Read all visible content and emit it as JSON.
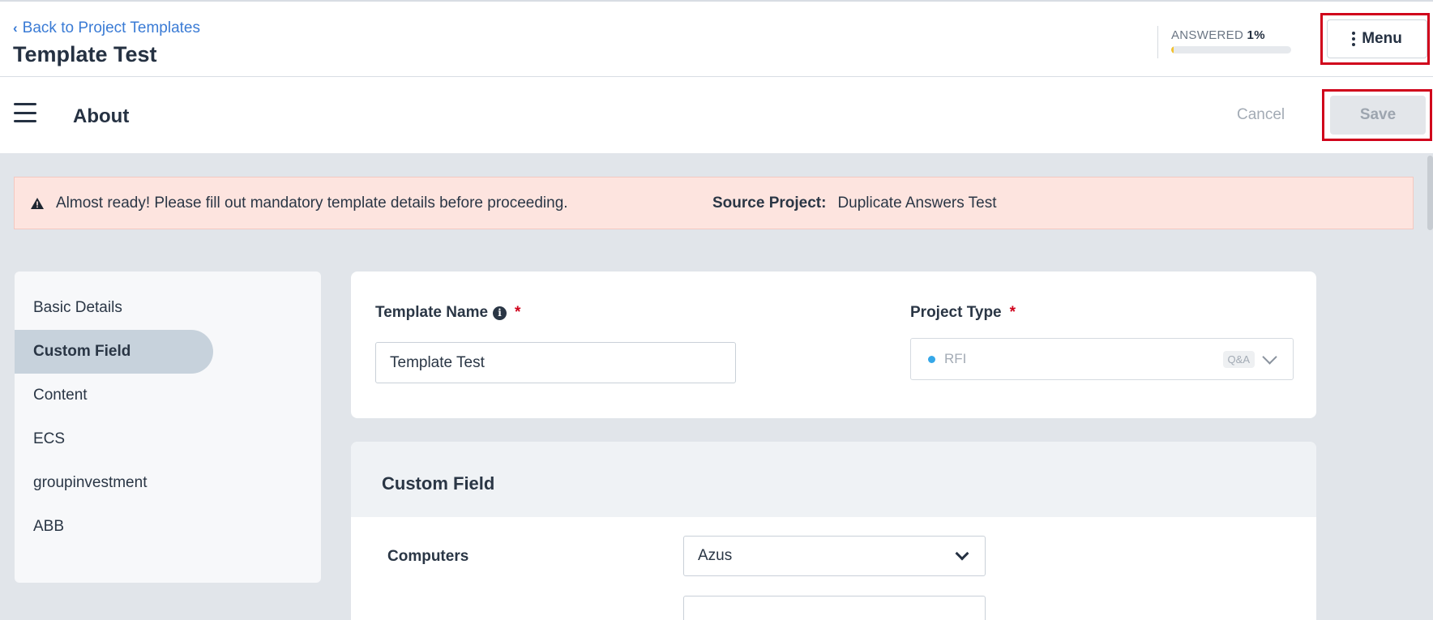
{
  "header": {
    "back_link": "Back to Project Templates",
    "title": "Template Test",
    "answered_label": "ANSWERED",
    "answered_percent": "1%",
    "answered_progress": 0.01,
    "menu_label": "Menu"
  },
  "subheader": {
    "title": "About",
    "cancel_label": "Cancel",
    "save_label": "Save"
  },
  "alert": {
    "message": "Almost ready! Please fill out mandatory template details before proceeding.",
    "source_label": "Source Project:",
    "source_value": "Duplicate Answers Test"
  },
  "sidebar": {
    "items": [
      {
        "label": "Basic Details",
        "active": false
      },
      {
        "label": "Custom Field",
        "active": true
      },
      {
        "label": "Content",
        "active": false
      },
      {
        "label": "ECS",
        "active": false
      },
      {
        "label": "groupinvestment",
        "active": false
      },
      {
        "label": "ABB",
        "active": false
      }
    ]
  },
  "form": {
    "template_name_label": "Template Name",
    "template_name_value": "Template Test",
    "project_type_label": "Project Type",
    "project_type_value": "RFI",
    "project_type_badge": "Q&A",
    "required_mark": "*"
  },
  "custom_field": {
    "title": "Custom Field",
    "rows": [
      {
        "label": "Computers",
        "value": "Azus"
      }
    ]
  },
  "colors": {
    "accent_link": "#3a7bd5",
    "highlight_box": "#d0021b",
    "alert_bg": "#fde4df",
    "progress": "#f2c230"
  }
}
